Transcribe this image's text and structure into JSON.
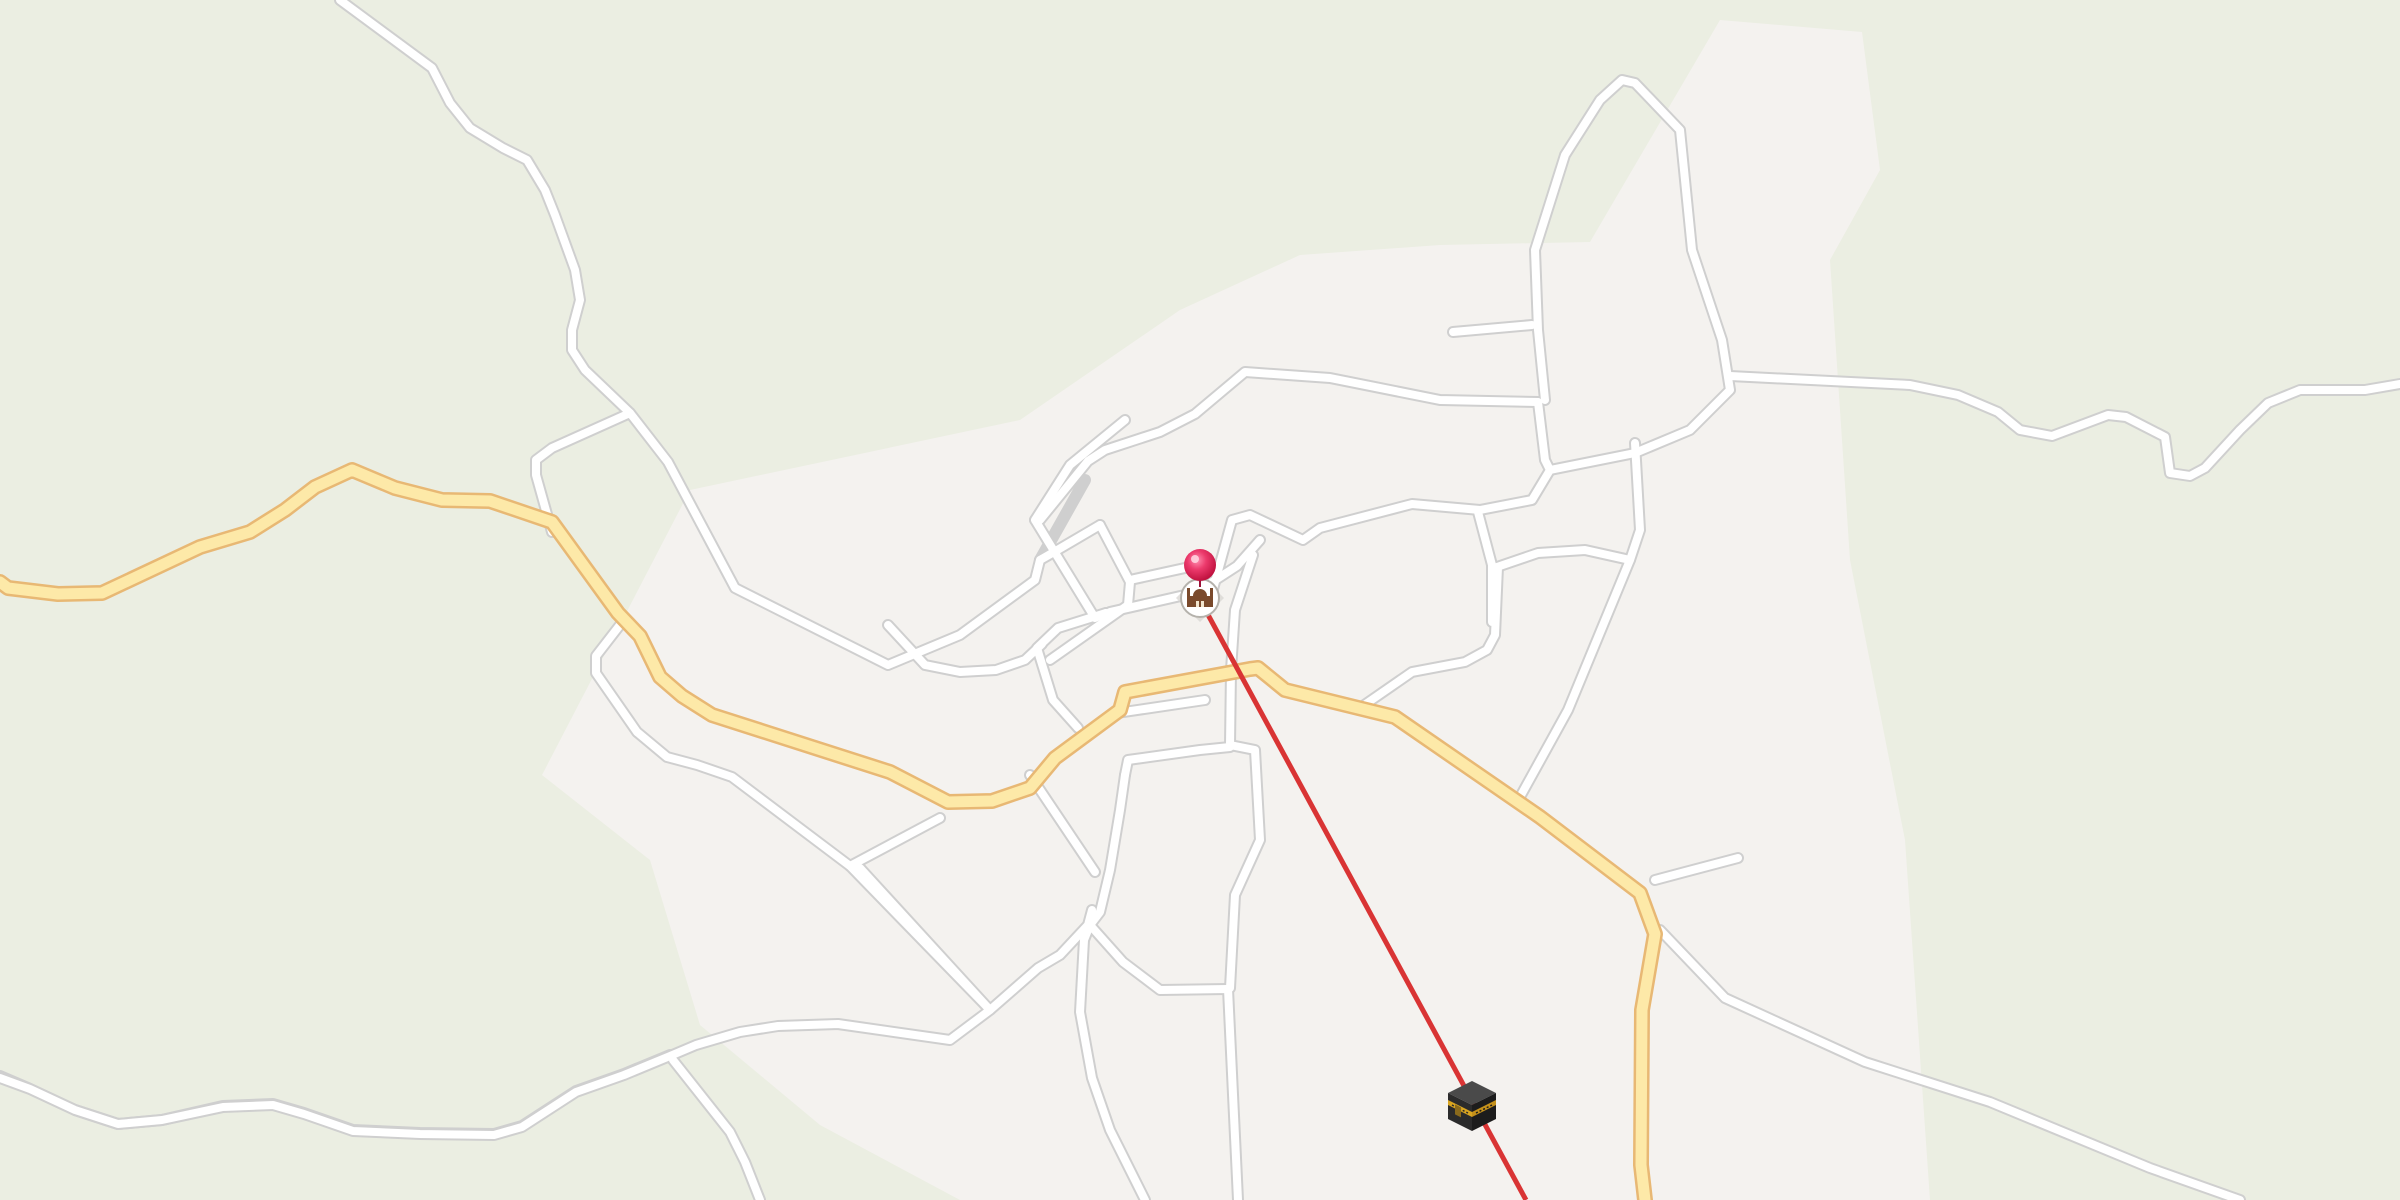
{
  "map": {
    "colors": {
      "land": "#ebeee2",
      "urban": "#f4f2ef",
      "minor_road": "#ffffff",
      "minor_road_casing": "#cfcfcf",
      "major_road": "#fde9a8",
      "major_road_casing": "#e8b874",
      "qibla_line": "#d93434",
      "pin": "#e5245a"
    },
    "markers": {
      "location_pin": {
        "icon": "pin-icon"
      },
      "mosque": {
        "icon": "mosque-icon"
      },
      "kaaba": {
        "icon": "kaaba-icon"
      }
    },
    "qibla_line": {
      "visible": true
    }
  }
}
